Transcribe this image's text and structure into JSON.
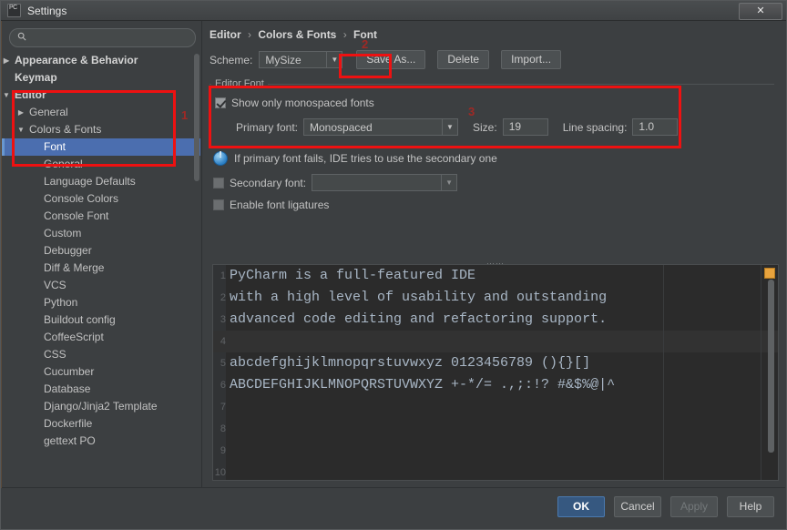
{
  "window": {
    "title": "Settings",
    "app_icon": "pycharm-icon",
    "close_label": "✕"
  },
  "sidebar": {
    "search": {
      "placeholder": "",
      "value": "",
      "icon": "search-icon"
    },
    "items": [
      {
        "label": "Appearance & Behavior",
        "depth": 0,
        "arrow": "▶",
        "bold": true,
        "selected": false
      },
      {
        "label": "Keymap",
        "depth": 0,
        "arrow": "",
        "bold": true,
        "selected": false
      },
      {
        "label": "Editor",
        "depth": 0,
        "arrow": "▼",
        "bold": true,
        "selected": false
      },
      {
        "label": "General",
        "depth": 1,
        "arrow": "▶",
        "bold": false,
        "selected": false
      },
      {
        "label": "Colors & Fonts",
        "depth": 1,
        "arrow": "▼",
        "bold": false,
        "selected": false
      },
      {
        "label": "Font",
        "depth": 2,
        "arrow": "",
        "bold": false,
        "selected": true
      },
      {
        "label": "General",
        "depth": 2,
        "arrow": "",
        "bold": false,
        "selected": false
      },
      {
        "label": "Language Defaults",
        "depth": 2,
        "arrow": "",
        "bold": false,
        "selected": false
      },
      {
        "label": "Console Colors",
        "depth": 2,
        "arrow": "",
        "bold": false,
        "selected": false
      },
      {
        "label": "Console Font",
        "depth": 2,
        "arrow": "",
        "bold": false,
        "selected": false
      },
      {
        "label": "Custom",
        "depth": 2,
        "arrow": "",
        "bold": false,
        "selected": false
      },
      {
        "label": "Debugger",
        "depth": 2,
        "arrow": "",
        "bold": false,
        "selected": false
      },
      {
        "label": "Diff & Merge",
        "depth": 2,
        "arrow": "",
        "bold": false,
        "selected": false
      },
      {
        "label": "VCS",
        "depth": 2,
        "arrow": "",
        "bold": false,
        "selected": false
      },
      {
        "label": "Python",
        "depth": 2,
        "arrow": "",
        "bold": false,
        "selected": false
      },
      {
        "label": "Buildout config",
        "depth": 2,
        "arrow": "",
        "bold": false,
        "selected": false
      },
      {
        "label": "CoffeeScript",
        "depth": 2,
        "arrow": "",
        "bold": false,
        "selected": false
      },
      {
        "label": "CSS",
        "depth": 2,
        "arrow": "",
        "bold": false,
        "selected": false
      },
      {
        "label": "Cucumber",
        "depth": 2,
        "arrow": "",
        "bold": false,
        "selected": false
      },
      {
        "label": "Database",
        "depth": 2,
        "arrow": "",
        "bold": false,
        "selected": false
      },
      {
        "label": "Django/Jinja2 Template",
        "depth": 2,
        "arrow": "",
        "bold": false,
        "selected": false
      },
      {
        "label": "Dockerfile",
        "depth": 2,
        "arrow": "",
        "bold": false,
        "selected": false
      },
      {
        "label": "gettext PO",
        "depth": 2,
        "arrow": "",
        "bold": false,
        "selected": false
      }
    ]
  },
  "breadcrumb": {
    "part1": "Editor",
    "sep1": "›",
    "part2": "Colors & Fonts",
    "sep2": "›",
    "part3": "Font"
  },
  "scheme_row": {
    "label": "Scheme:",
    "value": "MySize",
    "arrow": "▼",
    "save_as": "Save As...",
    "delete": "Delete",
    "import": "Import..."
  },
  "editor_font": {
    "group_title": "Editor Font",
    "show_monospaced": {
      "label": "Show only monospaced fonts",
      "checked": true
    },
    "primary_font": {
      "label": "Primary font:",
      "value": "Monospaced",
      "arrow": "▼"
    },
    "size": {
      "label": "Size:",
      "value": "19"
    },
    "line_spacing": {
      "label": "Line spacing:",
      "value": "1.0"
    },
    "info": {
      "icon": "info-icon",
      "text": "If primary font fails, IDE tries to use the secondary one"
    },
    "secondary_font": {
      "label": "Secondary font:",
      "value": "",
      "checked": false,
      "arrow": "▼"
    },
    "ligatures": {
      "label": "Enable font ligatures",
      "checked": false
    }
  },
  "preview": {
    "splitter_handle": "⋯⋯",
    "marker_color": "#e8a33d",
    "lines": [
      {
        "n": "1",
        "text": "PyCharm is a full-featured IDE",
        "current": false
      },
      {
        "n": "2",
        "text": "with a high level of usability and outstanding",
        "current": false
      },
      {
        "n": "3",
        "text": "advanced code editing and refactoring support.",
        "current": false
      },
      {
        "n": "4",
        "text": "",
        "current": true
      },
      {
        "n": "5",
        "text": "abcdefghijklmnopqrstuvwxyz 0123456789 (){}[]",
        "current": false
      },
      {
        "n": "6",
        "text": "ABCDEFGHIJKLMNOPQRSTUVWXYZ +-*/= .,;:!? #&$%@|^",
        "current": false
      },
      {
        "n": "7",
        "text": "",
        "current": false
      },
      {
        "n": "8",
        "text": "",
        "current": false
      },
      {
        "n": "9",
        "text": "",
        "current": false
      },
      {
        "n": "10",
        "text": "",
        "current": false
      }
    ]
  },
  "footer": {
    "ok": "OK",
    "cancel": "Cancel",
    "apply": "Apply",
    "help": "Help"
  },
  "annotations": {
    "n1": "1",
    "n2": "2",
    "n3": "3",
    "highlight_color": "#ee1111"
  }
}
